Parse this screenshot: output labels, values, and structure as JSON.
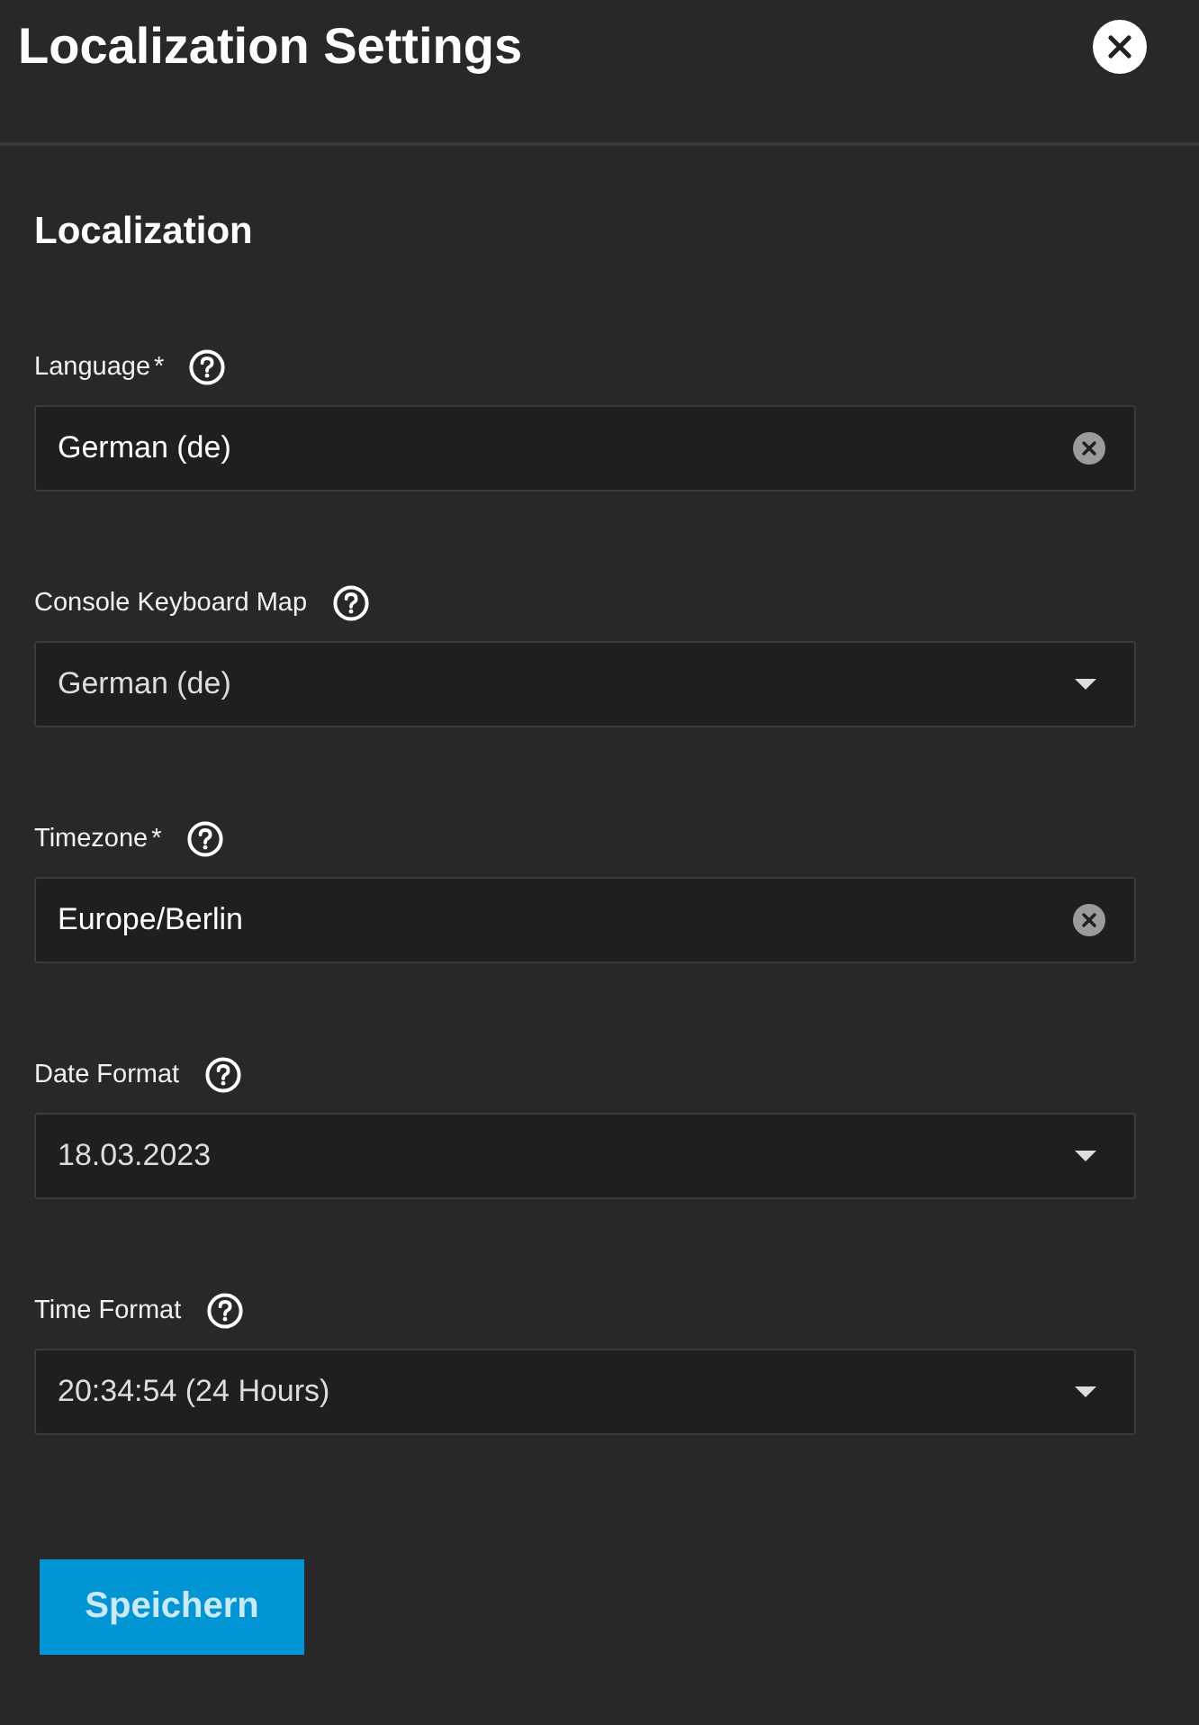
{
  "dialog": {
    "title": "Localization Settings"
  },
  "section": {
    "title": "Localization"
  },
  "fields": [
    {
      "kind": "autocomplete",
      "label": "Language",
      "required_mark": "*",
      "value": "German (de)"
    },
    {
      "kind": "select",
      "label": "Console Keyboard Map",
      "value": "German (de)"
    },
    {
      "kind": "autocomplete",
      "label": "Timezone",
      "required_mark": "*",
      "value": "Europe/Berlin"
    },
    {
      "kind": "select",
      "label": "Date Format",
      "value": "18.03.2023"
    },
    {
      "kind": "select",
      "label": "Time Format",
      "value": "20:34:54 (24 Hours)"
    }
  ],
  "buttons": [
    {
      "label": "Speichern"
    }
  ]
}
